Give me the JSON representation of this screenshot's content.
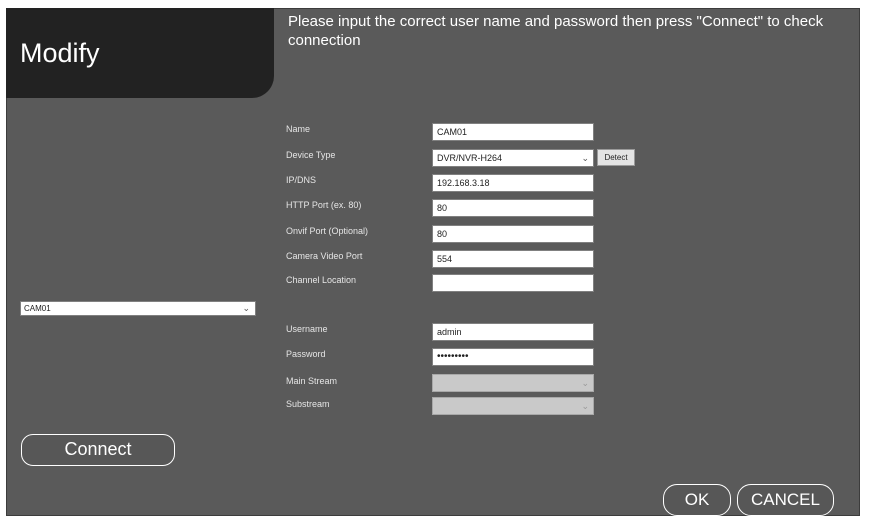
{
  "header": {
    "title": "Modify",
    "instruction": "Please input the correct user name and password then press \"Connect\" to check connection"
  },
  "left": {
    "camera_select_value": "CAM01"
  },
  "form": {
    "name_label": "Name",
    "name_value": "CAM01",
    "device_type_label": "Device Type",
    "device_type_value": "DVR/NVR-H264",
    "detect_label": "Detect",
    "ip_label": "IP/DNS",
    "ip_value": "192.168.3.18",
    "http_port_label": "HTTP Port (ex. 80)",
    "http_port_value": "80",
    "onvif_port_label": "Onvif Port (Optional)",
    "onvif_port_value": "80",
    "camera_video_port_label": "Camera Video Port",
    "camera_video_port_value": "554",
    "channel_location_label": "Channel Location",
    "channel_location_value": "",
    "username_label": "Username",
    "username_value": "admin",
    "password_label": "Password",
    "password_value": "•••••••••",
    "main_stream_label": "Main Stream",
    "main_stream_value": "",
    "substream_label": "Substream",
    "substream_value": ""
  },
  "buttons": {
    "connect": "Connect",
    "ok": "OK",
    "cancel": "CANCEL"
  },
  "icons": {
    "dropdown": "chevron-down-icon"
  }
}
